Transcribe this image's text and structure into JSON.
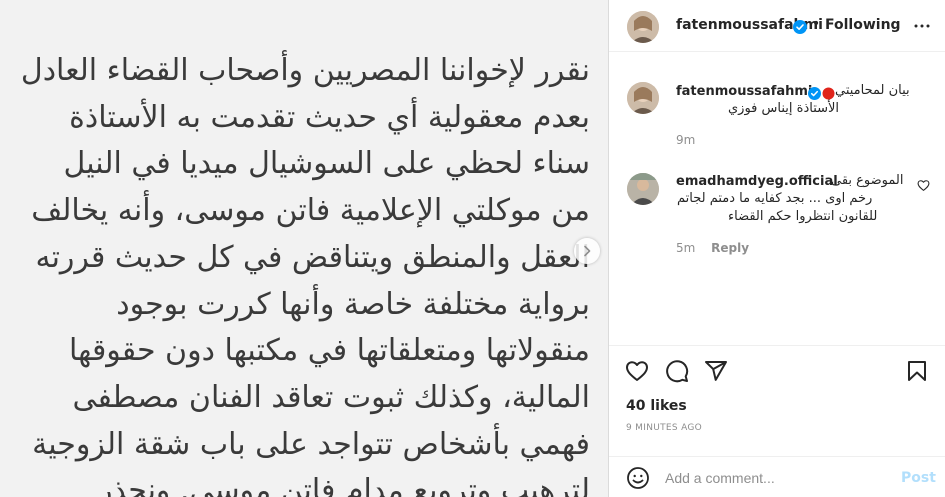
{
  "post_image": {
    "lines": [
      "نقرر لإخواننا المصريين وأصحاب القضاء العادل",
      "بعدم معقولية أي حديث تقدمت به الأستاذة",
      "سناء لحظي على السوشيال ميديا في النيل",
      "من موكلتي الإعلامية فاتن موسى، وأنه يخالف",
      "العقل والمنطق ويتناقض في كل حديث قررته",
      "برواية مختلفة خاصة وأنها كررت بوجود",
      "منقولاتها ومتعلقاتها في مكتبها دون حقوقها",
      "المالية، وكذلك ثبوت تعاقد الفنان مصطفى",
      "فهمي بأشخاص تتواجد على باب شقة الزوجية",
      "لترهيب وترويع مدام فاتن موسى. ونحذر"
    ]
  },
  "header": {
    "username": "fatenmoussafahmi",
    "separator": "•",
    "follow_status": "Following"
  },
  "caption": {
    "username": "fatenmoussafahmi",
    "line1": "بيان لمحاميتي",
    "line2": "الأستاذة إيناس فوزي",
    "time": "9m"
  },
  "comments": [
    {
      "username": "emadhamdyeg.official",
      "line1": "الموضوع بقى",
      "line2": "رخم اوى ... بجد كفايه ما دمتم لجاتم",
      "line3": "للقانون انتظروا حكم القضاء",
      "time": "5m",
      "reply_label": "Reply"
    }
  ],
  "likes": "40 likes",
  "timestamp": "9 MINUTES AGO",
  "add_comment": {
    "placeholder": "Add a comment...",
    "post_label": "Post"
  },
  "colors": {
    "verified": "#0095f6",
    "post_disabled": "#b2dffc",
    "red_circle": "#e0241b"
  }
}
